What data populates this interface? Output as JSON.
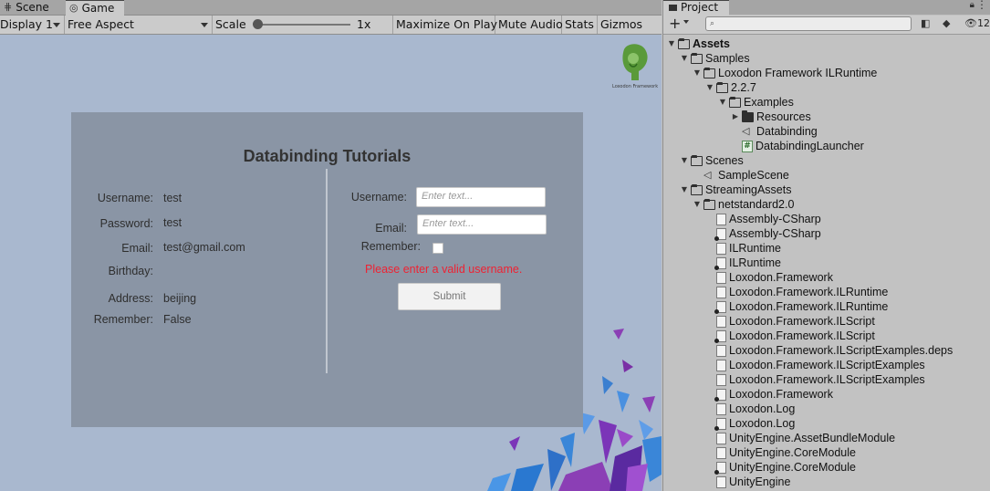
{
  "tabs": {
    "scene": "Scene",
    "game": "Game",
    "project": "Project"
  },
  "game_toolbar": {
    "display": "Display 1",
    "aspect": "Free Aspect",
    "scale_label": "Scale",
    "scale_value": "1x",
    "maximize": "Maximize On Play",
    "mute": "Mute Audio",
    "stats": "Stats",
    "gizmos": "Gizmos"
  },
  "logo": {
    "text": "Loxodon Framework"
  },
  "panel": {
    "title": "Databinding Tutorials",
    "left": {
      "username_label": "Username:",
      "username_value": "test",
      "password_label": "Password:",
      "password_value": "test",
      "email_label": "Email:",
      "email_value": "test@gmail.com",
      "birthday_label": "Birthday:",
      "birthday_value": "",
      "address_label": "Address:",
      "address_value": "beijing",
      "remember_label": "Remember:",
      "remember_value": "False"
    },
    "right": {
      "username_label": "Username:",
      "username_placeholder": "Enter text...",
      "email_label": "Email:",
      "email_placeholder": "Enter text...",
      "remember_label": "Remember:",
      "error": "Please enter a valid username.",
      "submit": "Submit"
    }
  },
  "project": {
    "search_placeholder": "",
    "toolbar_count": "12",
    "tree": [
      {
        "label": "Assets",
        "type": "folder-open",
        "depth": 0,
        "expanded": true
      },
      {
        "label": "Samples",
        "type": "folder-open",
        "depth": 1,
        "expanded": true
      },
      {
        "label": "Loxodon Framework ILRuntime",
        "type": "folder-open",
        "depth": 2,
        "expanded": true
      },
      {
        "label": "2.2.7",
        "type": "folder-open",
        "depth": 3,
        "expanded": true
      },
      {
        "label": "Examples",
        "type": "folder-open",
        "depth": 4,
        "expanded": true
      },
      {
        "label": "Resources",
        "type": "folder",
        "depth": 5,
        "expanded": false
      },
      {
        "label": "Databinding",
        "type": "scene",
        "depth": 5
      },
      {
        "label": "DatabindingLauncher",
        "type": "cs",
        "depth": 5
      },
      {
        "label": "Scenes",
        "type": "folder-open",
        "depth": 1,
        "expanded": true
      },
      {
        "label": "SampleScene",
        "type": "scene",
        "depth": 2
      },
      {
        "label": "StreamingAssets",
        "type": "folder-open",
        "depth": 1,
        "expanded": true
      },
      {
        "label": "netstandard2.0",
        "type": "folder-open",
        "depth": 2,
        "expanded": true
      },
      {
        "label": "Assembly-CSharp",
        "type": "file",
        "depth": 3
      },
      {
        "label": "Assembly-CSharp",
        "type": "file-dark",
        "depth": 3
      },
      {
        "label": "ILRuntime",
        "type": "file",
        "depth": 3
      },
      {
        "label": "ILRuntime",
        "type": "file-dark",
        "depth": 3
      },
      {
        "label": "Loxodon.Framework",
        "type": "file",
        "depth": 3
      },
      {
        "label": "Loxodon.Framework.ILRuntime",
        "type": "file",
        "depth": 3
      },
      {
        "label": "Loxodon.Framework.ILRuntime",
        "type": "file-dark",
        "depth": 3
      },
      {
        "label": "Loxodon.Framework.ILScript",
        "type": "file",
        "depth": 3
      },
      {
        "label": "Loxodon.Framework.ILScript",
        "type": "file-dark",
        "depth": 3
      },
      {
        "label": "Loxodon.Framework.ILScriptExamples.deps",
        "type": "file-json",
        "depth": 3
      },
      {
        "label": "Loxodon.Framework.ILScriptExamples",
        "type": "file",
        "depth": 3
      },
      {
        "label": "Loxodon.Framework.ILScriptExamples",
        "type": "file",
        "depth": 3
      },
      {
        "label": "Loxodon.Framework",
        "type": "file-dark",
        "depth": 3
      },
      {
        "label": "Loxodon.Log",
        "type": "file",
        "depth": 3
      },
      {
        "label": "Loxodon.Log",
        "type": "file-dark",
        "depth": 3
      },
      {
        "label": "UnityEngine.AssetBundleModule",
        "type": "file",
        "depth": 3
      },
      {
        "label": "UnityEngine.CoreModule",
        "type": "file",
        "depth": 3
      },
      {
        "label": "UnityEngine.CoreModule",
        "type": "file-dark",
        "depth": 3
      },
      {
        "label": "UnityEngine",
        "type": "file",
        "depth": 3
      }
    ]
  },
  "colors": {
    "game_bg": "#a9b8cf",
    "panel_bg": "#8a95a5",
    "error": "#ee2233",
    "editor_bg": "#c2c2c2"
  }
}
